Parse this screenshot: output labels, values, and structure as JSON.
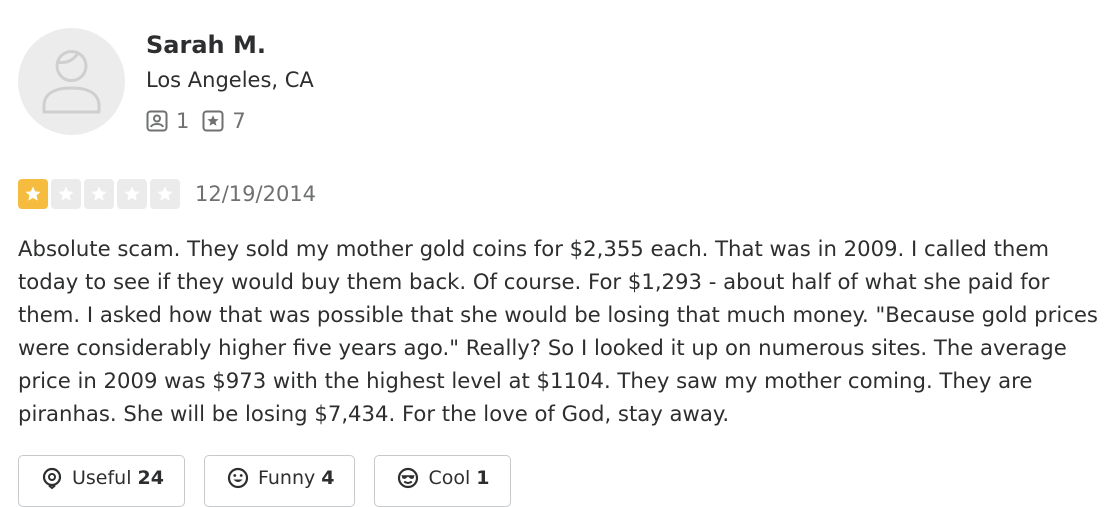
{
  "reviewer": {
    "name": "Sarah M.",
    "location": "Los Angeles, CA",
    "avatar_icon": "default-user-avatar-icon",
    "stats": [
      {
        "icon": "friends-icon",
        "count": "1"
      },
      {
        "icon": "reviews-star-icon",
        "count": "7"
      }
    ]
  },
  "review": {
    "rating": 1,
    "rating_max": 5,
    "date": "12/19/2014",
    "text": "Absolute scam.  They sold my mother gold coins for $2,355 each.  That was in 2009.  I called them today to see if they would buy them back.  Of course.  For $1,293 - about half of what she paid for them.  I asked how that was possible that she would be losing that much money.  \"Because gold prices were considerably higher five years ago.\"  Really?  So I looked it up on numerous sites.  The average price in 2009 was $973 with the highest level at $1104.  They saw my mother coming.  They are piranhas.  She will be losing $7,434.  For the love of God, stay away."
  },
  "reactions": [
    {
      "icon": "lightbulb-icon",
      "label": "Useful",
      "count": "24"
    },
    {
      "icon": "smile-icon",
      "label": "Funny",
      "count": "4"
    },
    {
      "icon": "sunglasses-icon",
      "label": "Cool",
      "count": "1"
    }
  ],
  "colors": {
    "star_filled": "#f5bc3f",
    "star_empty": "#ebebeb",
    "text": "#2d2e2f",
    "muted": "#6e7072",
    "border": "#c8c9ca"
  }
}
